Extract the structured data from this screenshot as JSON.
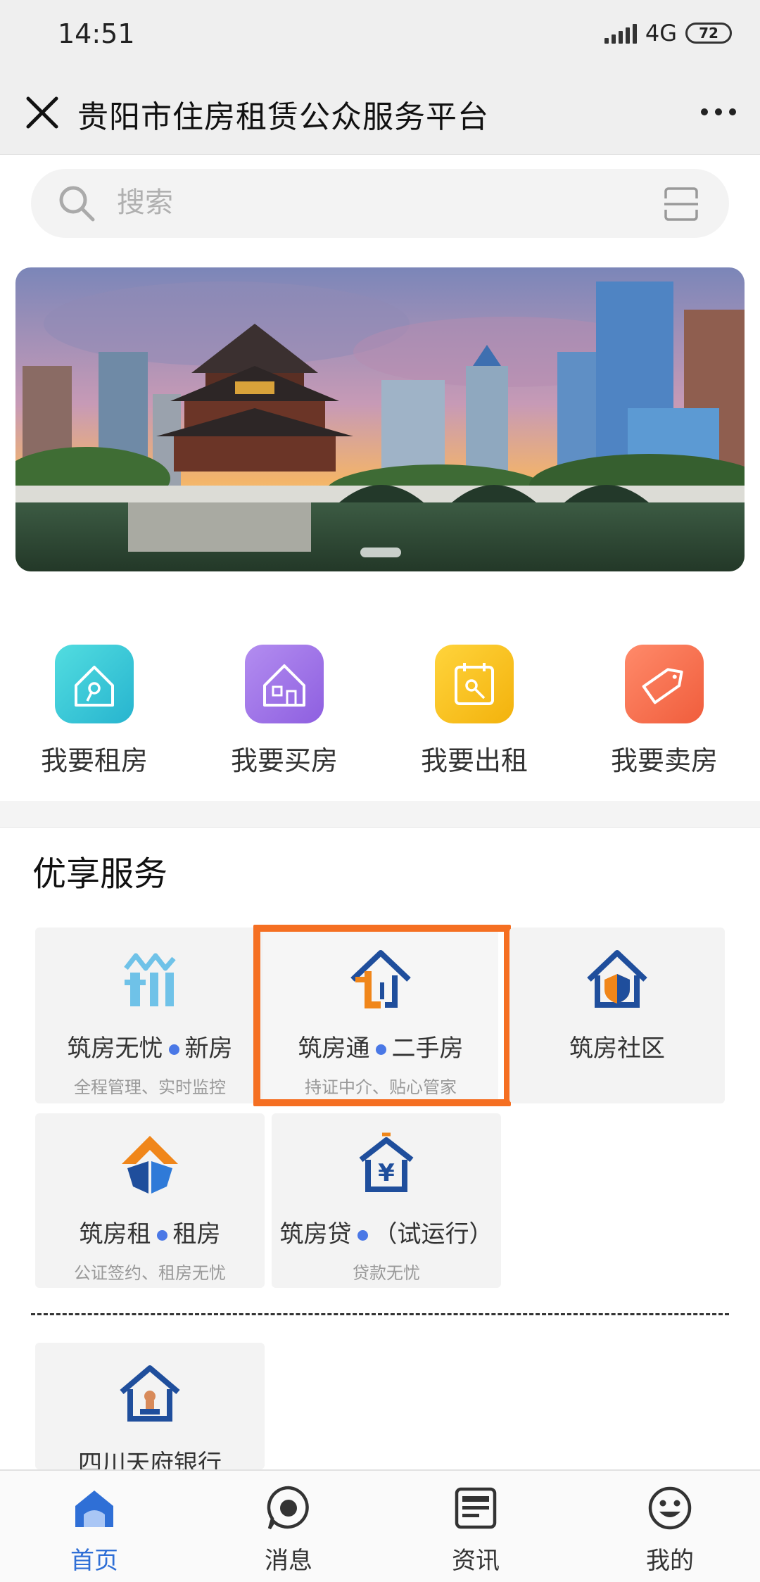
{
  "status_bar": {
    "time": "14:51",
    "network": "4G",
    "battery": "72"
  },
  "title_bar": {
    "title": "贵阳市住房租赁公众服务平台"
  },
  "search": {
    "placeholder": "搜索"
  },
  "quick_actions": [
    {
      "label": "我要租房",
      "icon": "key-house-icon",
      "color": "#3cc9d6"
    },
    {
      "label": "我要买房",
      "icon": "house-icon",
      "color": "#9c6ee8"
    },
    {
      "label": "我要出租",
      "icon": "calendar-key-icon",
      "color": "#f6c21e"
    },
    {
      "label": "我要卖房",
      "icon": "sale-tag-icon",
      "color": "#f4714c"
    }
  ],
  "services": {
    "title": "优享服务",
    "items": [
      {
        "name_a": "筑房无忧",
        "name_b": "新房",
        "sub": "全程管理、实时监控"
      },
      {
        "name_a": "筑房通",
        "name_b": "二手房",
        "sub": "持证中介、贴心管家"
      },
      {
        "name_a": "筑房社区",
        "name_b": "",
        "sub": ""
      },
      {
        "name_a": "筑房租",
        "name_b": "租房",
        "sub": "公证签约、租房无忧"
      },
      {
        "name_a": "筑房贷",
        "name_b": "（试运行）",
        "sub": "贷款无忧"
      },
      {
        "name_a": "四川天府银行",
        "name_b": "",
        "sub": ""
      }
    ]
  },
  "bottom_nav": [
    {
      "label": "首页",
      "icon": "home-icon",
      "active": true
    },
    {
      "label": "消息",
      "icon": "message-icon",
      "active": false
    },
    {
      "label": "资讯",
      "icon": "news-icon",
      "active": false
    },
    {
      "label": "我的",
      "icon": "smile-icon",
      "active": false
    }
  ],
  "colors": {
    "accent": "#2f6fd6",
    "highlight": "#f56f22",
    "brand_blue": "#1f4e9c",
    "brand_orange": "#f0861a"
  }
}
